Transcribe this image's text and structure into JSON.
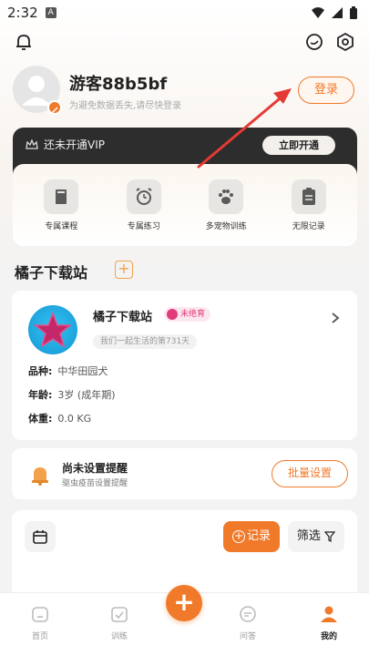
{
  "status_bar": {
    "time": "2:32",
    "notification_badge": "A"
  },
  "profile": {
    "username": "游客88b5bf",
    "subtitle": "为避免数据丢失,请尽快登录",
    "login_label": "登录"
  },
  "vip": {
    "status": "还未开通VIP",
    "open_label": "立即开通",
    "perks": [
      {
        "label": "专属课程",
        "icon": "book-icon"
      },
      {
        "label": "专属练习",
        "icon": "alarm-clock-icon"
      },
      {
        "label": "多宠物训练",
        "icon": "paw-icon"
      },
      {
        "label": "无限记录",
        "icon": "clipboard-icon"
      }
    ]
  },
  "pets_section": {
    "title": "橘子下载站"
  },
  "pet": {
    "name": "橘子下载站",
    "tag": "未绝育",
    "days": "我们一起生活的第731天",
    "rows": [
      {
        "key": "品种:",
        "value": "中华田园犬"
      },
      {
        "key": "年龄:",
        "value": "3岁 (成年期)"
      },
      {
        "key": "体重:",
        "value": "0.0 KG"
      }
    ]
  },
  "reminder": {
    "title": "尚未设置提醒",
    "subtitle": "驱虫疫苗设置提醒",
    "batch_label": "批量设置"
  },
  "log": {
    "record_label": "记录",
    "filter_label": "筛选"
  },
  "nav": {
    "items": [
      {
        "label": "首页",
        "icon": "home-icon"
      },
      {
        "label": "训练",
        "icon": "training-icon"
      },
      {
        "label": "问答",
        "icon": "chat-icon"
      },
      {
        "label": "我的",
        "icon": "person-icon",
        "active": true
      }
    ],
    "fab_label": "+"
  },
  "colors": {
    "accent": "#f07a2a",
    "vip_dark": "#2d2d2d",
    "annotation_arrow": "#e53935"
  }
}
